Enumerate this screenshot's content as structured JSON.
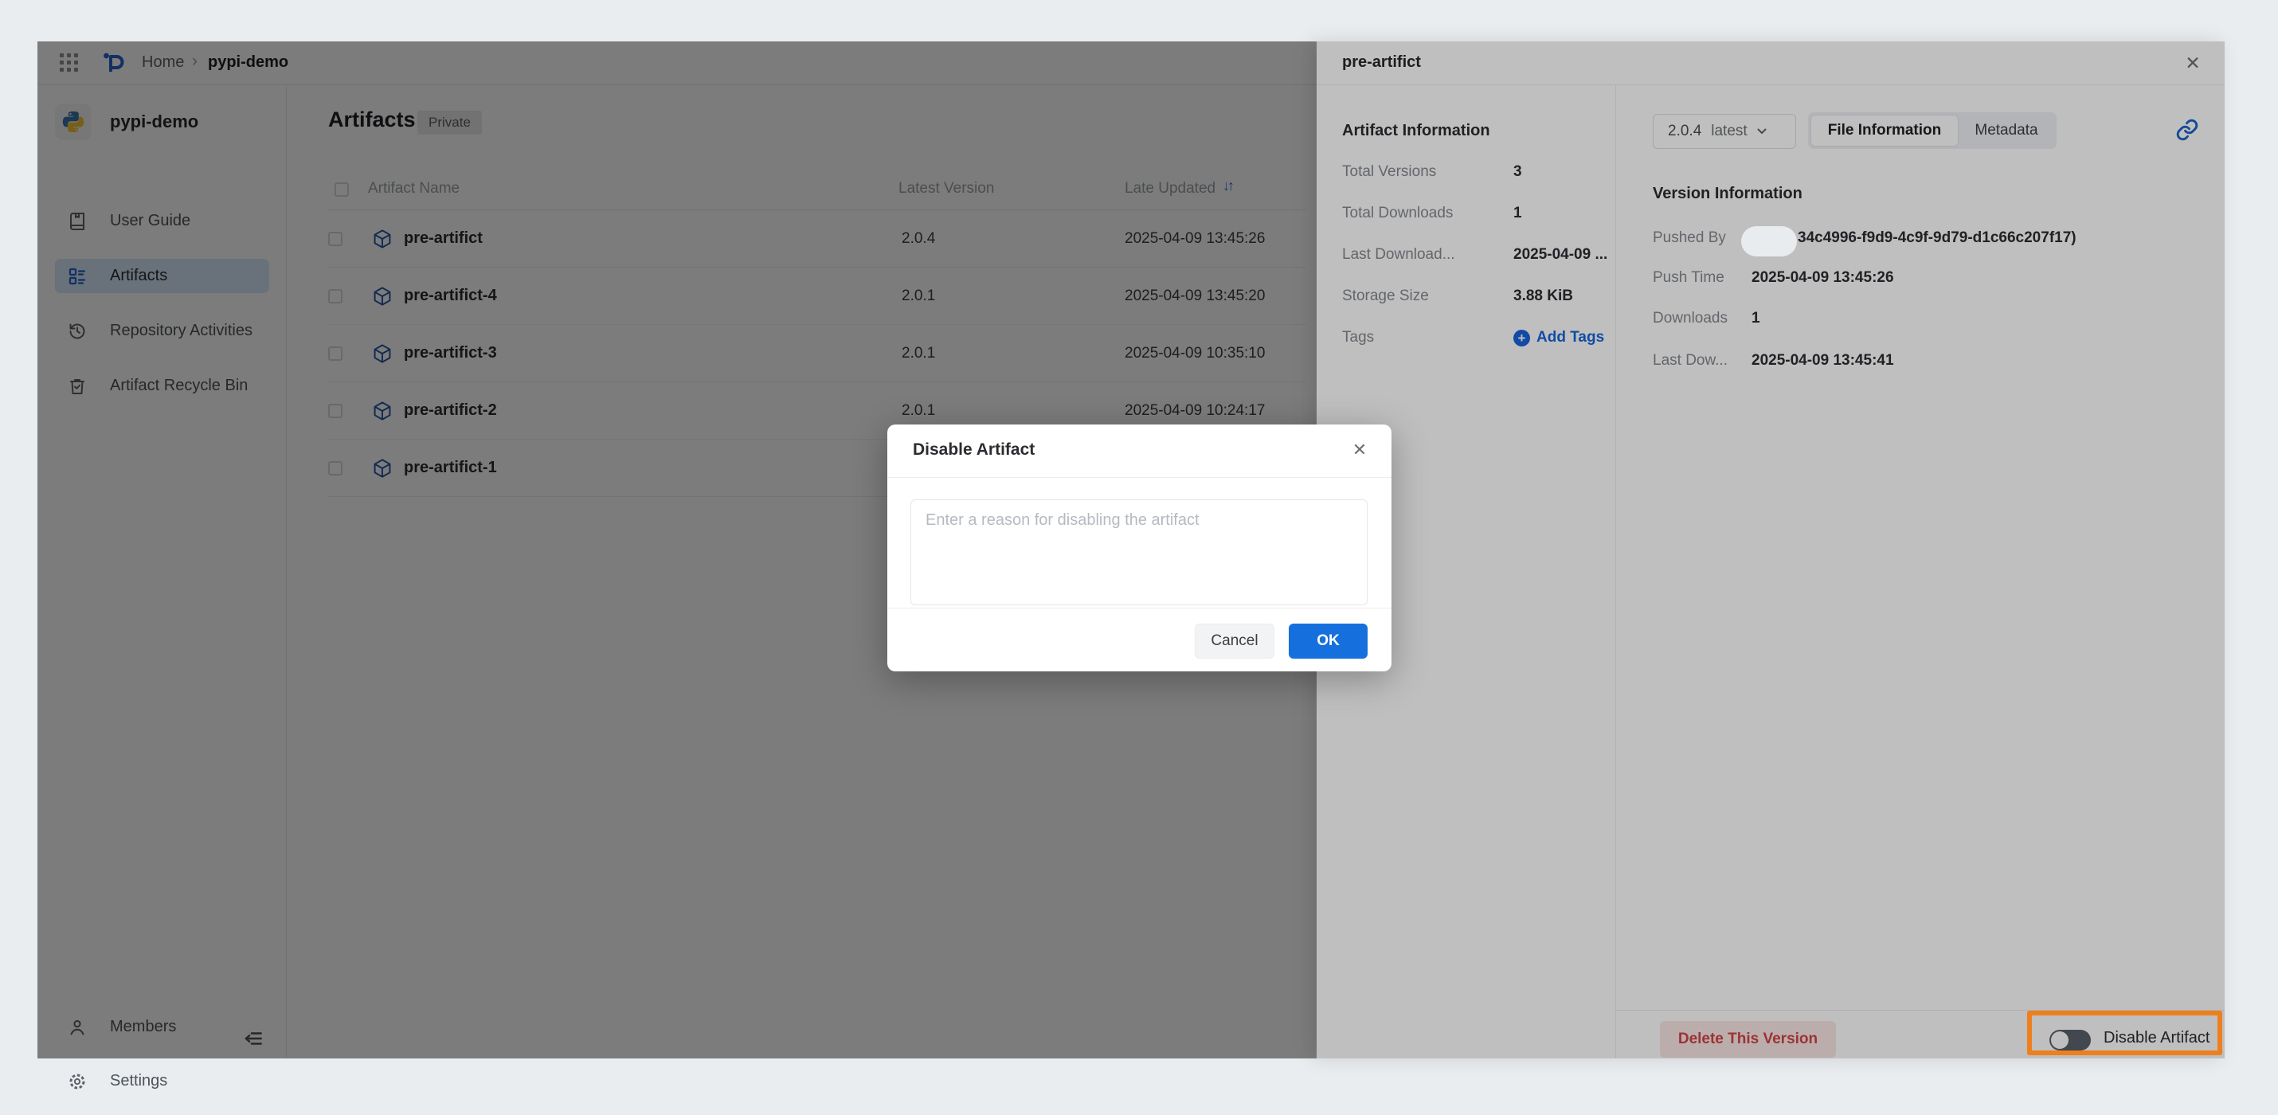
{
  "topbar": {
    "breadcrumb": {
      "home": "Home",
      "separator": "›",
      "current": "pypi-demo"
    }
  },
  "sidebar": {
    "repo_name": "pypi-demo",
    "items": [
      {
        "label": "User Guide",
        "icon": "book-icon"
      },
      {
        "label": "Artifacts",
        "icon": "artifacts-grid-icon"
      },
      {
        "label": "Repository Activities",
        "icon": "history-icon"
      },
      {
        "label": "Artifact Recycle Bin",
        "icon": "recycle-bin-icon"
      }
    ],
    "bottom_items": [
      {
        "label": "Members",
        "icon": "person-icon"
      },
      {
        "label": "Settings",
        "icon": "gear-icon"
      }
    ]
  },
  "main": {
    "title": "Artifacts",
    "badge": "Private",
    "table": {
      "headers": {
        "name": "Artifact Name",
        "version": "Latest Version",
        "updated": "Late Updated"
      },
      "sort_icon": "↓↑",
      "rows": [
        {
          "name": "pre-artifict",
          "version": "2.0.4",
          "updated": "2025-04-09 13:45:26"
        },
        {
          "name": "pre-artifict-4",
          "version": "2.0.1",
          "updated": "2025-04-09 13:45:20"
        },
        {
          "name": "pre-artifict-3",
          "version": "2.0.1",
          "updated": "2025-04-09 10:35:10"
        },
        {
          "name": "pre-artifict-2",
          "version": "2.0.1",
          "updated": "2025-04-09 10:24:17"
        },
        {
          "name": "pre-artifict-1",
          "version": "",
          "updated": ""
        }
      ]
    }
  },
  "drawer": {
    "title": "pre-artifict",
    "close": "✕",
    "artifact_info": {
      "heading": "Artifact Information",
      "rows": [
        {
          "label": "Total Versions",
          "value": "3"
        },
        {
          "label": "Total Downloads",
          "value": "1"
        },
        {
          "label": "Last Download...",
          "value": "2025-04-09 ..."
        },
        {
          "label": "Storage Size",
          "value": "3.88 KiB"
        }
      ],
      "tags_label": "Tags",
      "add_tags": "Add Tags"
    },
    "version_bar": {
      "version": "2.0.4",
      "tag": "latest",
      "tab_file": "File Information",
      "tab_meta": "Metadata"
    },
    "version_info": {
      "heading": "Version Information",
      "rows": [
        {
          "label": "Pushed By",
          "value": "34c4996-f9d9-4c9f-9d79-d1c66c207f17)"
        },
        {
          "label": "Push Time",
          "value": "2025-04-09 13:45:26"
        },
        {
          "label": "Downloads",
          "value": "1"
        },
        {
          "label": "Last Dow...",
          "value": "2025-04-09 13:45:41"
        }
      ]
    },
    "footer": {
      "delete_button": "Delete This Version",
      "toggle_label": "Disable Artifact"
    }
  },
  "modal": {
    "title": "Disable Artifact",
    "close": "✕",
    "placeholder": "Enter a reason for disabling the artifact",
    "cancel": "Cancel",
    "ok": "OK"
  },
  "colors": {
    "accent_blue": "#2563c9",
    "ok_blue": "#1570dd",
    "danger_red": "#cf4444",
    "annotation_orange": "#ee7f1d",
    "active_item_bg": "#d8e8fb"
  }
}
